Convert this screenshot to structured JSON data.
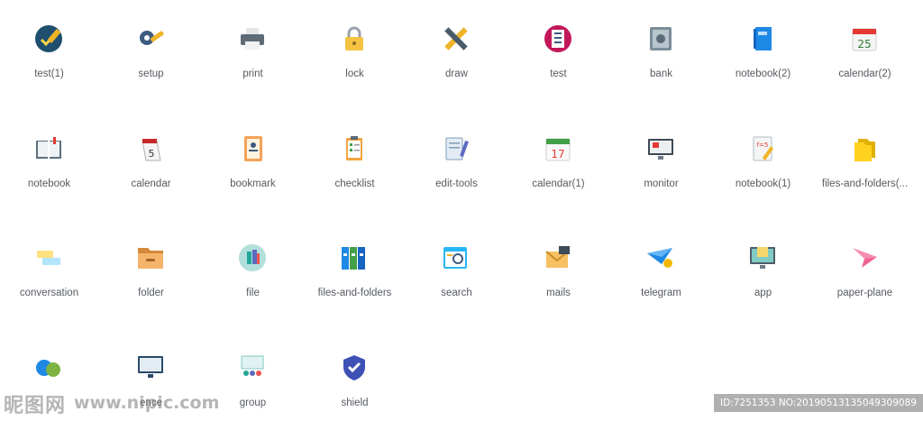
{
  "icons": [
    {
      "label": "test(1)",
      "icon": "test-badge-icon"
    },
    {
      "label": "setup",
      "icon": "gear-wrench-icon"
    },
    {
      "label": "print",
      "icon": "printer-icon"
    },
    {
      "label": "lock",
      "icon": "padlock-icon"
    },
    {
      "label": "draw",
      "icon": "pencil-ruler-icon"
    },
    {
      "label": "test",
      "icon": "clipboard-checklist-icon"
    },
    {
      "label": "bank",
      "icon": "safe-icon"
    },
    {
      "label": "notebook(2)",
      "icon": "blue-notebook-icon"
    },
    {
      "label": "calendar(2)",
      "icon": "calendar-25-icon"
    },
    {
      "label": "notebook",
      "icon": "open-book-icon"
    },
    {
      "label": "calendar",
      "icon": "desk-calendar-icon"
    },
    {
      "label": "bookmark",
      "icon": "address-book-icon"
    },
    {
      "label": "checklist",
      "icon": "checklist-clipboard-icon"
    },
    {
      "label": "edit-tools",
      "icon": "notepad-pencil-icon"
    },
    {
      "label": "calendar(1)",
      "icon": "calendar-17-icon"
    },
    {
      "label": "monitor",
      "icon": "monitor-icon"
    },
    {
      "label": "notebook(1)",
      "icon": "math-notebook-icon"
    },
    {
      "label": "files-and-folders(...",
      "icon": "yellow-folders-icon"
    },
    {
      "label": "conversation",
      "icon": "chat-bubbles-icon"
    },
    {
      "label": "folder",
      "icon": "folder-icon"
    },
    {
      "label": "file",
      "icon": "files-circle-icon"
    },
    {
      "label": "files-and-folders",
      "icon": "binders-icon"
    },
    {
      "label": "search",
      "icon": "search-window-icon"
    },
    {
      "label": "mails",
      "icon": "envelope-icon"
    },
    {
      "label": "telegram",
      "icon": "telegram-plane-icon"
    },
    {
      "label": "app",
      "icon": "app-monitor-icon"
    },
    {
      "label": "paper-plane",
      "icon": "paper-plane-icon"
    },
    {
      "label": "",
      "icon": "chat-bubbles-blue-green-icon"
    },
    {
      "label": "ence",
      "icon": "presentation-monitor-icon"
    },
    {
      "label": "group",
      "icon": "group-board-icon"
    },
    {
      "label": "shield",
      "icon": "shield-check-icon"
    }
  ],
  "watermark": {
    "logo": "昵图网",
    "url": "www.nipic.com",
    "id": "ID:7251353 NO:20190513135049309089"
  }
}
